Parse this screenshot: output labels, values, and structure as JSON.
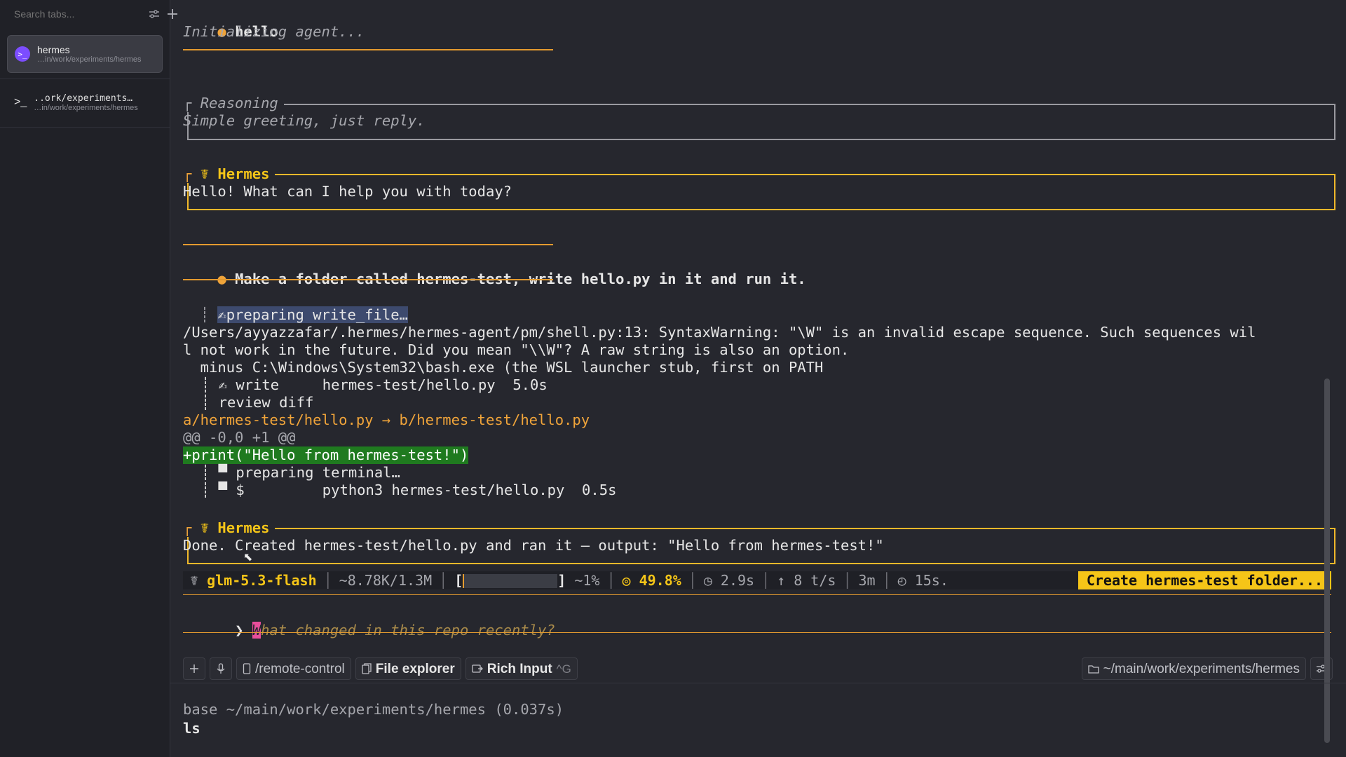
{
  "sidebar": {
    "search_placeholder": "Search tabs...",
    "tabs": [
      {
        "title": "hermes",
        "path": "…in/work/experiments/hermes",
        "icon": ">_"
      },
      {
        "title": "..ork/experiments…",
        "path": "…in/work/experiments/hermes",
        "icon": ">_"
      }
    ]
  },
  "term": {
    "user1_msg": "hello",
    "init": "Initializing agent...",
    "reasoning_title": "Reasoning",
    "reasoning_text": "Simple greeting, just reply.",
    "hermes_title": "Hermes",
    "hermes_reply1": "Hello! What can I help you with today?",
    "user2_msg": "Make a folder called hermes-test, write hello.py in it and run it.",
    "prep_write": "✍preparing write_file…",
    "warn1": "/Users/ayyazzafar/.hermes/hermes-agent/pm/shell.py:13: SyntaxWarning: \"\\W\" is an invalid escape sequence. Such sequences wil",
    "warn2": "l not work in the future. Did you mean \"\\\\W\"? A raw string is also an option.",
    "warn3": "  minus C:\\Windows\\System32\\bash.exe (the WSL launcher stub, first on PATH",
    "write_line": "┊ ✍ write     hermes-test/hello.py  5.0s",
    "review_line": "┊ review diff",
    "diff_files": "a/hermes-test/hello.py → b/hermes-test/hello.py",
    "diff_hunk": "@@ -0,0 +1 @@",
    "diff_add": "+print(\"Hello from hermes-test!\")",
    "prep_term": "┊ ▀ preparing terminal…",
    "run_line": "┊ ▀ $         python3 hermes-test/hello.py  0.5s",
    "hermes_reply2": "Done. Created hermes-test/hello.py and ran it — output: \"Hello from hermes-test!\""
  },
  "status": {
    "model": "glm-5.3-flash",
    "tokens": "~8.78K/1.3M",
    "ctx_pct": "~1%",
    "ctx_fill": 0.01,
    "cache": "◎ 49.8%",
    "latency": "◷ 2.9s",
    "rate": "↑ 8 t/s",
    "elapsed": "3m",
    "timer": "◴ 15s.",
    "task": "Create hermes-test folder..."
  },
  "prompt": {
    "chevron": "❯",
    "placeholder_first": "W",
    "placeholder_rest": "hat changed in this repo recently?"
  },
  "toolbar": {
    "remote_label": "/remote-control",
    "explorer_label": "File explorer",
    "rich_label": "Rich Input",
    "rich_kbd": "^G",
    "cwd_label": "~/main/work/experiments/hermes"
  },
  "shell": {
    "prompt_line": "base ~/main/work/experiments/hermes (0.037s)",
    "command": "ls"
  },
  "colors": {
    "accent": "#f5c518",
    "orange": "#e49a2f",
    "diff_add_bg": "#1f7a1f",
    "cursor": "#e84e9b"
  }
}
